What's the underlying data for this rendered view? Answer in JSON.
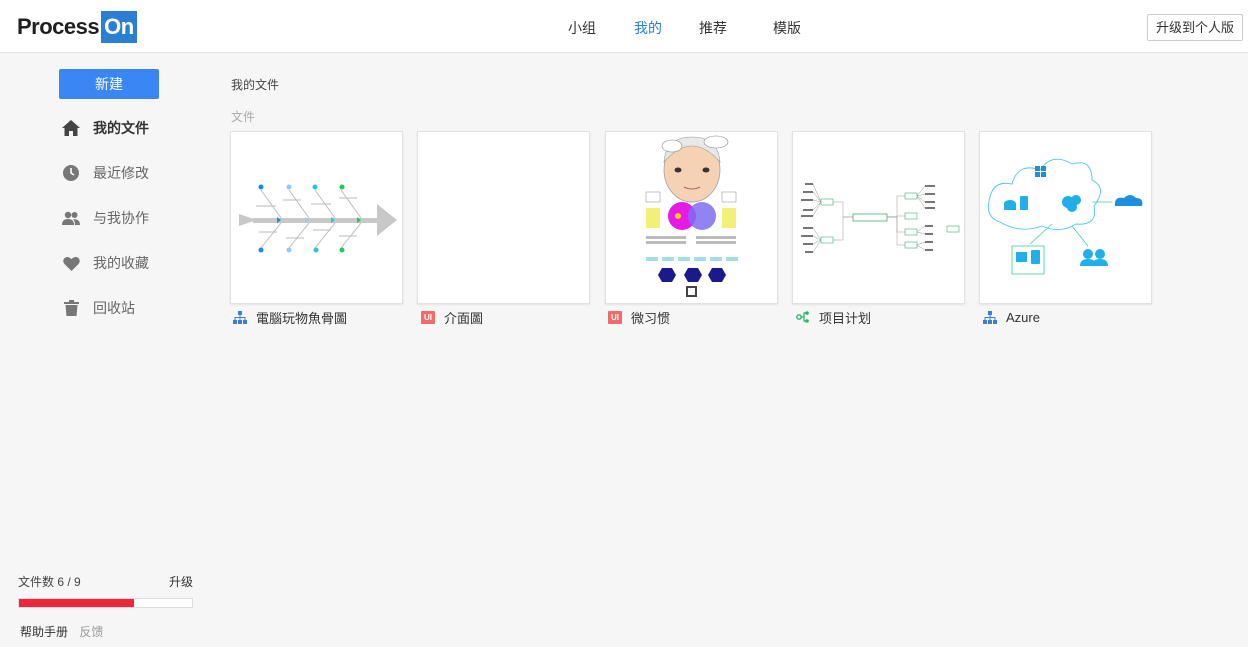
{
  "header": {
    "logo_part1": "Process",
    "logo_part2": "On",
    "nav": [
      "小组",
      "我的",
      "推荐",
      "模版"
    ],
    "active_nav": "我的",
    "upgrade_label": "升级到个人版"
  },
  "sidebar": {
    "new_label": "新建",
    "items": [
      {
        "label": "我的文件",
        "icon": "home-icon",
        "active": true
      },
      {
        "label": "最近修改",
        "icon": "clock-icon",
        "active": false
      },
      {
        "label": "与我协作",
        "icon": "people-icon",
        "active": false
      },
      {
        "label": "我的收藏",
        "icon": "heart-icon",
        "active": false
      },
      {
        "label": "回收站",
        "icon": "trash-icon",
        "active": false
      }
    ],
    "quota_label": "文件数 6 / 9",
    "quota_upgrade": "升级",
    "quota_used": 6,
    "quota_total": 9,
    "quota_color": "#f0243a",
    "help_label": "帮助手册",
    "feedback_label": "反馈"
  },
  "main": {
    "breadcrumb": "我的文件",
    "section_title": "文件",
    "files": [
      {
        "name": "電腦玩物魚骨圖",
        "type": "flowchart",
        "type_icon": "org-chart-icon"
      },
      {
        "name": "介面圖",
        "type": "ui",
        "type_icon": "ui-badge-icon",
        "badge": "UI"
      },
      {
        "name": "微习惯",
        "type": "ui",
        "type_icon": "ui-badge-icon",
        "badge": "UI"
      },
      {
        "name": "项目计划",
        "type": "mindmap",
        "type_icon": "mindmap-icon"
      },
      {
        "name": "Azure",
        "type": "flowchart",
        "type_icon": "org-chart-icon"
      }
    ]
  },
  "colors": {
    "accent": "#2a7fd4",
    "new_button": "#3b86f5",
    "ui_badge": "#f26b6b",
    "mindmap_icon": "#2db36a"
  }
}
